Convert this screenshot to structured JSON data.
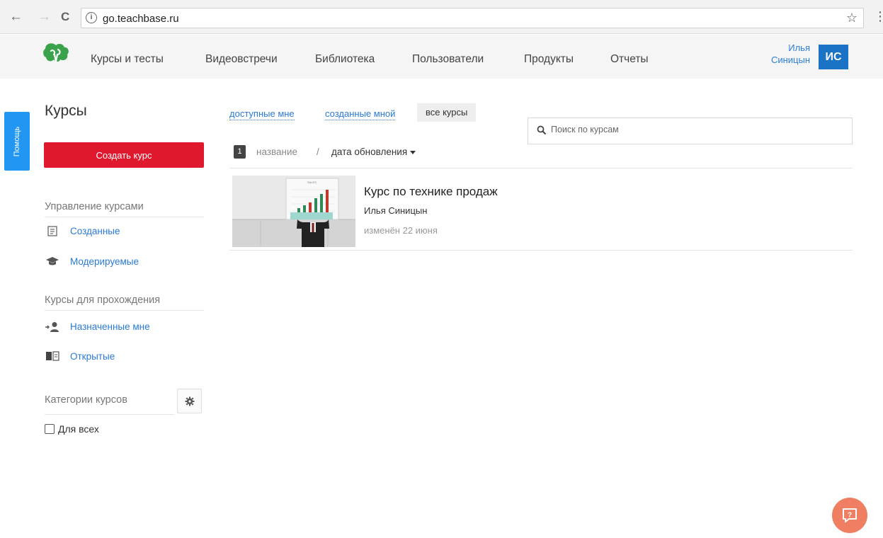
{
  "browser": {
    "url": "go.teachbase.ru",
    "back_glyph": "←",
    "forward_glyph": "→",
    "reload_glyph": "C",
    "info_glyph": "i",
    "star_glyph": "☆",
    "menu_glyph": "⋮"
  },
  "header": {
    "menu": [
      "Курсы и тесты",
      "Видеовстречи",
      "Библиотека",
      "Пользователи",
      "Продукты",
      "Отчеты"
    ],
    "user": {
      "first_name": "Илья",
      "last_name": "Синицын",
      "initials": "ИС"
    }
  },
  "help_tab": {
    "label": "Помощь"
  },
  "sidebar": {
    "title": "Курсы",
    "create_button": "Создать курс",
    "manage_heading": "Управление курсами",
    "manage_items": [
      {
        "label": "Созданные",
        "icon": "list-doc-icon"
      },
      {
        "label": "Модерируемые",
        "icon": "graduation-cap-icon"
      }
    ],
    "learning_heading": "Курсы для прохождения",
    "learning_items": [
      {
        "label": "Назначенные мне",
        "icon": "assign-user-icon"
      },
      {
        "label": "Открытые",
        "icon": "open-book-icon"
      }
    ],
    "categories_heading": "Категории курсов",
    "category_checkbox_label": "Для всех"
  },
  "main": {
    "tabs": [
      {
        "label": "доступные мне",
        "active": false
      },
      {
        "label": "созданные мной",
        "active": false
      },
      {
        "label": "все курсы",
        "active": true
      }
    ],
    "search_placeholder": "Поиск по курсам",
    "count": "1",
    "sort_name": "название",
    "sort_separator": "/",
    "sort_date": "дата обновления"
  },
  "courses": [
    {
      "title": "Курс по технике продаж",
      "author": "Илья Синицын",
      "updated": "изменён 22 июня",
      "thumb_caption": "SALES"
    }
  ],
  "colors": {
    "accent_blue": "#2a7ad2",
    "create_red": "#e0182e",
    "avatar_blue": "#1a73c5",
    "help_blue": "#2196f3",
    "feedback_orange": "#ef7e62"
  }
}
